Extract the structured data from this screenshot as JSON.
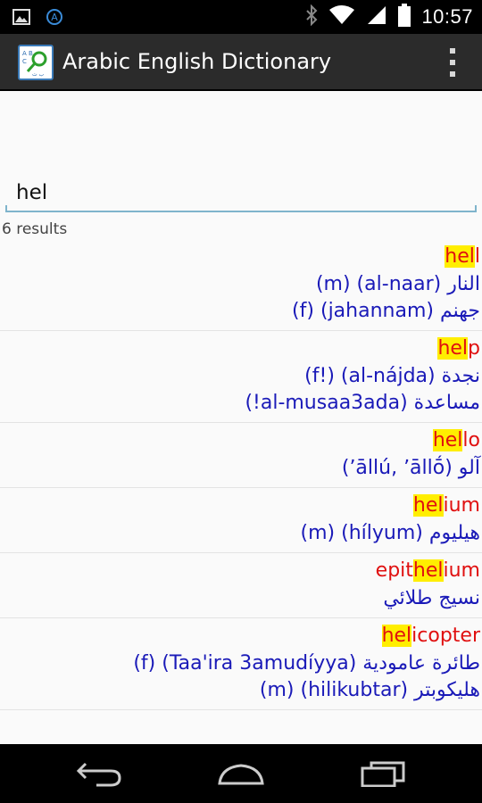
{
  "status_bar": {
    "time": "10:57",
    "icons": [
      "image-icon",
      "sync-icon",
      "bluetooth-icon",
      "wifi-icon",
      "signal-icon",
      "battery-icon"
    ]
  },
  "app": {
    "title": "Arabic English Dictionary"
  },
  "search": {
    "value": "hel",
    "placeholder": ""
  },
  "results_count": "6 results",
  "results": [
    {
      "pre": "",
      "match": "hel",
      "post": "l",
      "lines": [
        "النار (al-naar) (m)",
        "جهنم (jahannam) (f)"
      ]
    },
    {
      "pre": "",
      "match": "hel",
      "post": "p",
      "lines": [
        "نجدة (al-nájda) (!f)",
        "مساعدة (al-musaa3ada!)"
      ]
    },
    {
      "pre": "",
      "match": "hel",
      "post": "lo",
      "lines": [
        "آلو (ʼāllú, ʼāllṓ)"
      ]
    },
    {
      "pre": "",
      "match": "hel",
      "post": "ium",
      "lines": [
        "هيليوم (hílyum) (m)"
      ]
    },
    {
      "pre": "epit",
      "match": "hel",
      "post": "ium",
      "lines": [
        "نسيج طلائي"
      ]
    },
    {
      "pre": "",
      "match": "hel",
      "post": "icopter",
      "lines": [
        "طائرة عامودية (Taa'ira 3amudíyya) (f)",
        "هليكوبتر (hilikubtar) (m)"
      ]
    }
  ],
  "colors": {
    "headword": "#e01010",
    "highlight": "#ffee00",
    "translation": "#1a1ab8",
    "action_bar": "#2b2b2b",
    "search_underline": "#7fb4cc"
  },
  "nav_bar": {
    "icons": [
      "back-icon",
      "home-icon",
      "recent-apps-icon"
    ]
  }
}
